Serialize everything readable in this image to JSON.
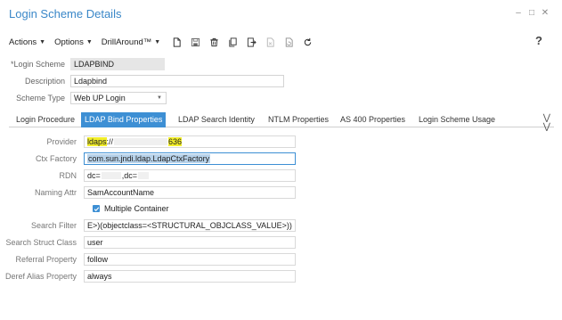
{
  "window": {
    "title": "Login Scheme Details",
    "controls": [
      "minimize-icon",
      "restore-icon",
      "close-icon"
    ]
  },
  "toolbar": {
    "menus": [
      "Actions",
      "Options",
      "DrillAround™"
    ],
    "icons": [
      "new-document-icon",
      "save-icon",
      "delete-icon",
      "copy-icon",
      "export-icon",
      "disabled-document-icon",
      "revert-icon",
      "refresh-icon"
    ],
    "help": "?"
  },
  "header": {
    "login_scheme": {
      "label": "*Login Scheme",
      "value": "LDAPBIND"
    },
    "description": {
      "label": "Description",
      "value": "Ldapbind"
    },
    "scheme_type": {
      "label": "Scheme Type",
      "value": "Web UP Login"
    }
  },
  "tabs": [
    "Login Procedure",
    "LDAP Bind Properties",
    "LDAP Search Identity",
    "NTLM Properties",
    "AS 400 Properties",
    "Login Scheme Usage"
  ],
  "active_tab": "LDAP Bind Properties",
  "fields": {
    "provider": {
      "label": "Provider",
      "v1": "ldaps",
      "v2": "://",
      "v3": "636"
    },
    "ctx_factory": {
      "label": "Ctx Factory",
      "value": "com.sun.jndi.ldap.LdapCtxFactory"
    },
    "rdn": {
      "label": "RDN",
      "p1": "dc=",
      "p2": ",dc="
    },
    "naming_attr": {
      "label": "Naming Attr",
      "value": "SamAccountName"
    },
    "multiple_container": {
      "label": "Multiple Container",
      "checked": true
    },
    "search_filter": {
      "label": "Search Filter",
      "value": "E>)(objectclass=<STRUCTURAL_OBJCLASS_VALUE>))"
    },
    "search_struct_class": {
      "label": "Search Struct Class",
      "value": "user"
    },
    "referral_property": {
      "label": "Referral Property",
      "value": "follow"
    },
    "deref_alias_property": {
      "label": "Deref Alias Property",
      "value": "always"
    }
  },
  "colors": {
    "accent": "#3d8fd4",
    "title": "#3a87c8",
    "highlight": "#f2ee2a"
  }
}
